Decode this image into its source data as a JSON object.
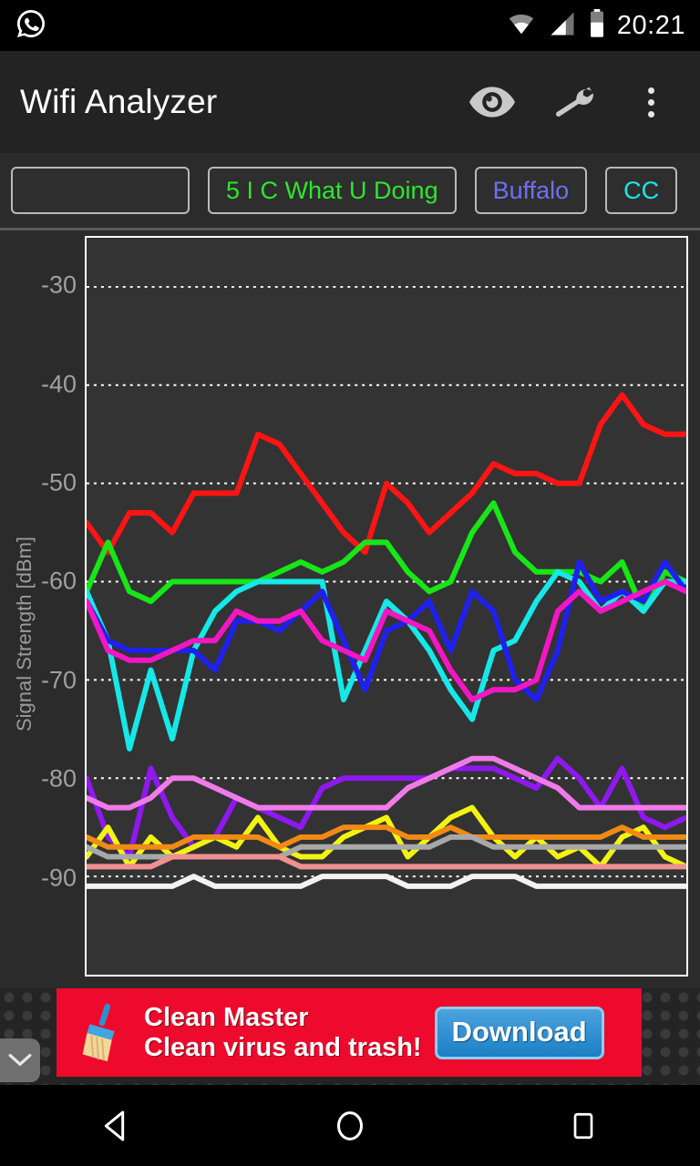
{
  "statusbar": {
    "notification_icon": "whatsapp-icon",
    "wifi_icon": "wifi-icon",
    "cell_icon": "cell-signal-icon",
    "battery_icon": "battery-icon",
    "time": "20:21"
  },
  "appbar": {
    "title": "Wifi Analyzer",
    "eye_icon": "eye-icon",
    "wrench_icon": "wrench-icon",
    "overflow_icon": "overflow-menu-icon"
  },
  "chips": [
    {
      "label": "",
      "color": "#cccccc"
    },
    {
      "label": "5 I C What U Doing",
      "color": "#2ee62e"
    },
    {
      "label": "Buffalo",
      "color": "#6f6ff0"
    },
    {
      "label": "CC",
      "color": "#19e8e8"
    }
  ],
  "ad": {
    "title": "Clean Master",
    "subtitle": "Clean virus and trash!",
    "button": "Download",
    "brand_color": "#ee0a2c",
    "button_color": "#2f8fcf",
    "icon": "broom-icon",
    "collapse_icon": "chevron-down-icon"
  },
  "navbar": {
    "back": "back-icon",
    "home": "home-icon",
    "recents": "recents-icon"
  },
  "chart_data": {
    "type": "line",
    "title": "",
    "xlabel": "",
    "ylabel": "Signal Strength [dBm]",
    "ylim": [
      -100,
      -25
    ],
    "yticks": [
      -30,
      -40,
      -50,
      -60,
      -70,
      -80,
      -90
    ],
    "ytick_labels": [
      "-30",
      "-40",
      "-50",
      "-60",
      "-70",
      "-80",
      "-90"
    ],
    "grid": true,
    "grid_style": "dotted-white",
    "legend": "none",
    "x": [
      0,
      1,
      2,
      3,
      4,
      5,
      6,
      7,
      8,
      9,
      10,
      11,
      12,
      13,
      14,
      15,
      16,
      17,
      18,
      19,
      20,
      21,
      22,
      23,
      24,
      25,
      26,
      27,
      28
    ],
    "xlim": [
      0,
      28
    ],
    "series": [
      {
        "name": "red-ap",
        "color": "#ff1414",
        "values": [
          -54,
          -57,
          -53,
          -53,
          -55,
          -51,
          -51,
          -51,
          -45,
          -46,
          -49,
          -52,
          -55,
          -57,
          -50,
          -52,
          -55,
          -53,
          -51,
          -48,
          -49,
          -49,
          -50,
          -50,
          -44,
          -41,
          -44,
          -45,
          -45
        ]
      },
      {
        "name": "green-ap",
        "color": "#17e617",
        "values": [
          -61,
          -56,
          -61,
          -62,
          -60,
          -60,
          -60,
          -60,
          -60,
          -59,
          -58,
          -59,
          -58,
          -56,
          -56,
          -59,
          -61,
          -60,
          -55,
          -52,
          -57,
          -59,
          -59,
          -59,
          -60,
          -58,
          -63,
          -59,
          -60
        ]
      },
      {
        "name": "cyan-ap",
        "color": "#16e8e8",
        "values": [
          -61,
          -66,
          -77,
          -69,
          -76,
          -67,
          -63,
          -61,
          -60,
          -60,
          -60,
          -60,
          -72,
          -67,
          -62,
          -64,
          -67,
          -71,
          -74,
          -67,
          -66,
          -62,
          -59,
          -60,
          -63,
          -61,
          -63,
          -60,
          -60
        ]
      },
      {
        "name": "blue-ap",
        "color": "#2020ee",
        "values": [
          -62,
          -66,
          -67,
          -67,
          -67,
          -67,
          -69,
          -64,
          -64,
          -65,
          -63,
          -61,
          -66,
          -71,
          -65,
          -64,
          -62,
          -67,
          -61,
          -63,
          -70,
          -72,
          -67,
          -58,
          -62,
          -61,
          -62,
          -58,
          -61
        ]
      },
      {
        "name": "magenta-ap",
        "color": "#f316c3",
        "values": [
          -62,
          -67,
          -68,
          -68,
          -67,
          -66,
          -66,
          -63,
          -64,
          -64,
          -63,
          -66,
          -67,
          -68,
          -63,
          -64,
          -65,
          -69,
          -72,
          -71,
          -71,
          -70,
          -63,
          -61,
          -63,
          -62,
          -61,
          -60,
          -61
        ]
      },
      {
        "name": "purple-ap",
        "color": "#8f18f0",
        "values": [
          -80,
          -86,
          -88,
          -79,
          -84,
          -87,
          -86,
          -82,
          -83,
          -84,
          -85,
          -81,
          -80,
          -80,
          -80,
          -80,
          -80,
          -79,
          -79,
          -79,
          -80,
          -81,
          -78,
          -80,
          -83,
          -79,
          -84,
          -85,
          -84
        ]
      },
      {
        "name": "violet-ap",
        "color": "#f07ae8",
        "values": [
          -82,
          -83,
          -83,
          -82,
          -80,
          -80,
          -81,
          -82,
          -83,
          -83,
          -83,
          -83,
          -83,
          -83,
          -83,
          -81,
          -80,
          -79,
          -78,
          -78,
          -79,
          -80,
          -81,
          -83,
          -83,
          -83,
          -83,
          -83,
          -83
        ]
      },
      {
        "name": "yellow-ap",
        "color": "#f3f312",
        "values": [
          -88,
          -85,
          -89,
          -86,
          -88,
          -87,
          -86,
          -87,
          -84,
          -87,
          -88,
          -88,
          -86,
          -85,
          -84,
          -88,
          -86,
          -84,
          -83,
          -86,
          -88,
          -86,
          -88,
          -87,
          -89,
          -86,
          -85,
          -88,
          -89
        ]
      },
      {
        "name": "orange-ap",
        "color": "#f08a14",
        "values": [
          -86,
          -87,
          -87,
          -87,
          -87,
          -86,
          -86,
          -86,
          -86,
          -87,
          -86,
          -86,
          -85,
          -85,
          -85,
          -86,
          -86,
          -85,
          -86,
          -86,
          -86,
          -86,
          -86,
          -86,
          -86,
          -85,
          -86,
          -86,
          -86
        ]
      },
      {
        "name": "white-ap",
        "color": "#f2f2f2",
        "values": [
          -91,
          -91,
          -91,
          -91,
          -91,
          -90,
          -91,
          -91,
          -91,
          -91,
          -91,
          -90,
          -90,
          -90,
          -90,
          -91,
          -91,
          -91,
          -90,
          -90,
          -90,
          -91,
          -91,
          -91,
          -91,
          -91,
          -91,
          -91,
          -91
        ]
      },
      {
        "name": "gray-ap",
        "color": "#a8a8a8",
        "values": [
          -87,
          -88,
          -88,
          -88,
          -88,
          -88,
          -88,
          -88,
          -88,
          -88,
          -87,
          -87,
          -87,
          -87,
          -87,
          -87,
          -87,
          -86,
          -86,
          -87,
          -87,
          -87,
          -87,
          -87,
          -87,
          -87,
          -87,
          -87,
          -87
        ]
      },
      {
        "name": "salmon-ap",
        "color": "#f09090",
        "values": [
          -89,
          -89,
          -89,
          -89,
          -88,
          -88,
          -88,
          -88,
          -88,
          -88,
          -89,
          -89,
          -89,
          -89,
          -89,
          -89,
          -89,
          -89,
          -89,
          -89,
          -89,
          -89,
          -89,
          -89,
          -89,
          -89,
          -89,
          -89,
          -89
        ]
      }
    ]
  }
}
